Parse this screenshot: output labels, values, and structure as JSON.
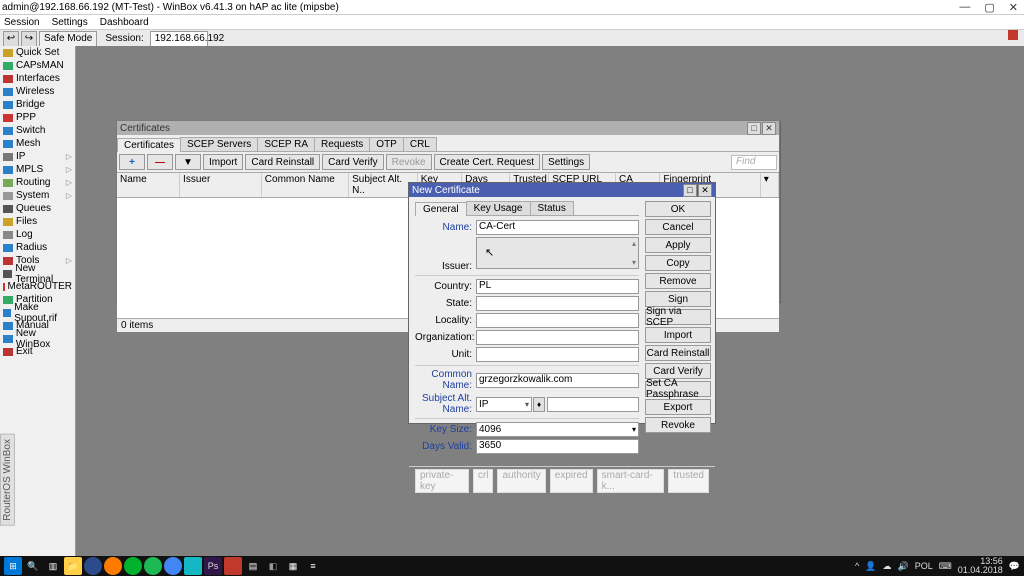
{
  "window": {
    "title": "admin@192.168.66.192 (MT-Test) - WinBox v6.41.3 on hAP ac lite (mipsbe)",
    "minimize": "—",
    "maximize": "▢",
    "close": "✕"
  },
  "menubar": {
    "session": "Session",
    "settings": "Settings",
    "dashboard": "Dashboard"
  },
  "toolbar": {
    "back": "↩",
    "fwd": "↪",
    "safe_mode": "Safe Mode",
    "session_label": "Session:",
    "session_ip": "192.168.66.192"
  },
  "sidebar": {
    "items": [
      {
        "label": "Quick Set",
        "color": "#c9a227"
      },
      {
        "label": "CAPsMAN",
        "color": "#3a6"
      },
      {
        "label": "Interfaces",
        "color": "#b33"
      },
      {
        "label": "Wireless",
        "color": "#2a80c9"
      },
      {
        "label": "Bridge",
        "color": "#2a80c9"
      },
      {
        "label": "PPP",
        "color": "#c33"
      },
      {
        "label": "Switch",
        "color": "#2a80c9"
      },
      {
        "label": "Mesh",
        "color": "#2a80c9"
      },
      {
        "label": "IP",
        "color": "#777",
        "exp": true
      },
      {
        "label": "MPLS",
        "color": "#2a80c9",
        "exp": true
      },
      {
        "label": "Routing",
        "color": "#7a5",
        "exp": true
      },
      {
        "label": "System",
        "color": "#999",
        "exp": true
      },
      {
        "label": "Queues",
        "color": "#555"
      },
      {
        "label": "Files",
        "color": "#c9a227"
      },
      {
        "label": "Log",
        "color": "#888"
      },
      {
        "label": "Radius",
        "color": "#2a80c9"
      },
      {
        "label": "Tools",
        "color": "#b33",
        "exp": true
      },
      {
        "label": "New Terminal",
        "color": "#555"
      },
      {
        "label": "MetaROUTER",
        "color": "#c33"
      },
      {
        "label": "Partition",
        "color": "#3a6"
      },
      {
        "label": "Make Supout.rif",
        "color": "#2a80c9"
      },
      {
        "label": "Manual",
        "color": "#2a80c9"
      },
      {
        "label": "New WinBox",
        "color": "#2a80c9"
      },
      {
        "label": "Exit",
        "color": "#b33"
      }
    ],
    "vtext": "RouterOS WinBox"
  },
  "cert_win": {
    "title": "Certificates",
    "tabs": [
      "Certificates",
      "SCEP Servers",
      "SCEP RA",
      "Requests",
      "OTP",
      "CRL"
    ],
    "tools": {
      "import": "Import",
      "card_reinstall": "Card Reinstall",
      "card_verify": "Card Verify",
      "revoke": "Revoke",
      "create_req": "Create Cert. Request",
      "settings": "Settings",
      "find_ph": "Find"
    },
    "cols": [
      "Name",
      "Issuer",
      "Common Name",
      "Subject Alt. N..",
      "Key Size",
      "Days Valid",
      "Trusted",
      "SCEP URL",
      "CA",
      "Fingerprint"
    ],
    "status": "0 items"
  },
  "dlg": {
    "title": "New Certificate",
    "tabs": {
      "general": "General",
      "key_usage": "Key Usage",
      "status": "Status"
    },
    "labels": {
      "name": "Name:",
      "issuer": "Issuer:",
      "country": "Country:",
      "state": "State:",
      "locality": "Locality:",
      "org": "Organization:",
      "unit": "Unit:",
      "cn": "Common Name:",
      "san": "Subject Alt. Name:",
      "key_size": "Key Size:",
      "days_valid": "Days Valid:"
    },
    "values": {
      "name": "CA-Cert",
      "issuer": "",
      "country": "PL",
      "state": "",
      "locality": "",
      "org": "",
      "unit": "",
      "cn": "grzegorzkowalik.com",
      "san_type": "IP",
      "san_val": "",
      "key_size": "4096",
      "days_valid": "3650"
    },
    "buttons": [
      "OK",
      "Cancel",
      "Apply",
      "Copy",
      "Remove",
      "Sign",
      "Sign via SCEP",
      "Import",
      "Card Reinstall",
      "Card Verify",
      "Set CA Passphrase",
      "Export",
      "Revoke"
    ],
    "flags": [
      "private-key",
      "crl",
      "authority",
      "expired",
      "smart-card-k...",
      "trusted"
    ]
  },
  "taskbar": {
    "clock_time": "13:56",
    "clock_date": "01.04.2018",
    "lang": "POL"
  }
}
